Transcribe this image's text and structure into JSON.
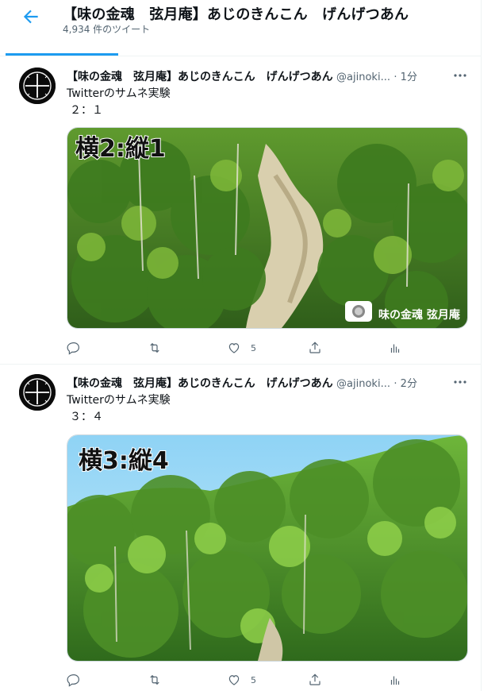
{
  "header": {
    "title": "【味の金魂　弦月庵】あじのきんこん　げんげつあん",
    "tweet_count": "4,934 件のツイート"
  },
  "tweets": [
    {
      "display_name": "【味の金魂　弦月庵】あじのきんこん　げんげつあん",
      "handle": "@ajinoki...",
      "time": "· 1分",
      "line1": "Twitterのサムネ実験",
      "line2": "２：１",
      "image_caption": "横2:縦1",
      "watermark": "味の金魂 弦月庵",
      "likes": "5"
    },
    {
      "display_name": "【味の金魂　弦月庵】あじのきんこん　げんげつあん",
      "handle": "@ajinoki...",
      "time": "· 2分",
      "line1": "Twitterのサムネ実験",
      "line2": "３：４",
      "image_caption": "横3:縦4",
      "likes": "5"
    }
  ],
  "icons": [
    "back-arrow-icon",
    "more-icon",
    "reply-icon",
    "retweet-icon",
    "like-icon",
    "share-icon",
    "analytics-icon"
  ],
  "colors": {
    "accent": "#1d9bf0",
    "secondary_text": "#536471",
    "border": "#eff3f4"
  }
}
